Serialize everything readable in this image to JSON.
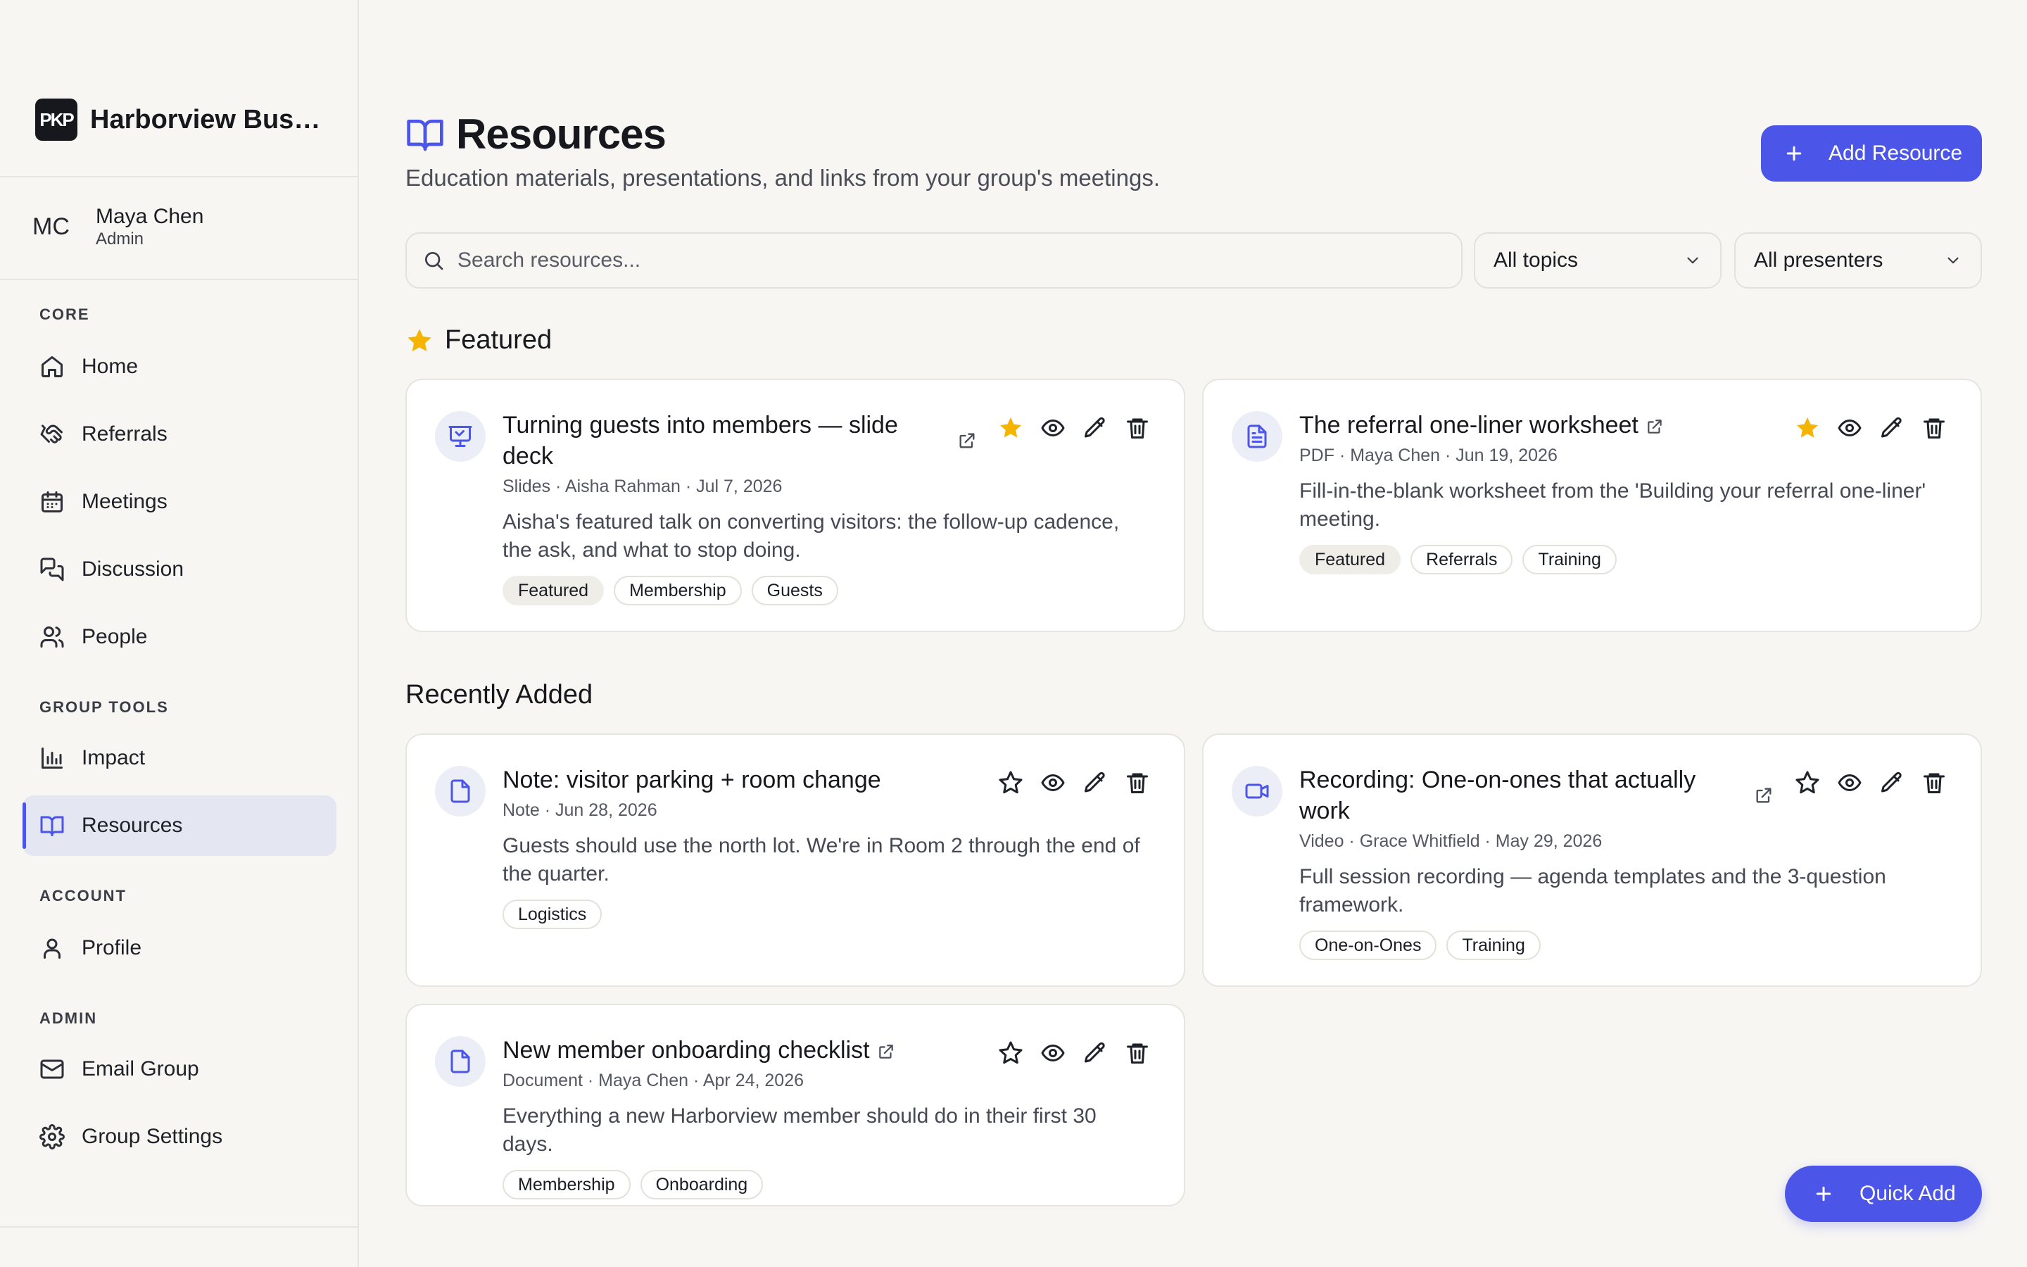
{
  "app": {
    "brand_name": "Harborview Busi...",
    "logo_text": "PKP"
  },
  "user": {
    "initials": "MC",
    "name": "Maya Chen",
    "role": "Admin"
  },
  "sidebar": {
    "sections": [
      {
        "label": "CORE",
        "items": [
          {
            "label": "Home",
            "icon": "home-icon"
          },
          {
            "label": "Referrals",
            "icon": "handshake-icon"
          },
          {
            "label": "Meetings",
            "icon": "calendar-icon"
          },
          {
            "label": "Discussion",
            "icon": "chat-icon"
          },
          {
            "label": "People",
            "icon": "people-icon"
          }
        ]
      },
      {
        "label": "GROUP TOOLS",
        "items": [
          {
            "label": "Impact",
            "icon": "bar-chart-icon"
          },
          {
            "label": "Resources",
            "icon": "book-icon",
            "active": true
          }
        ]
      },
      {
        "label": "ACCOUNT",
        "items": [
          {
            "label": "Profile",
            "icon": "user-icon"
          }
        ]
      },
      {
        "label": "ADMIN",
        "items": [
          {
            "label": "Email Group",
            "icon": "mail-icon"
          },
          {
            "label": "Group Settings",
            "icon": "gear-icon"
          }
        ]
      }
    ]
  },
  "page": {
    "title": "Resources",
    "subtitle": "Education materials, presentations, and links from your group's meetings.",
    "add_button": "Add Resource",
    "quick_add": "Quick Add"
  },
  "filters": {
    "search_placeholder": "Search resources...",
    "topic": "All topics",
    "presenter": "All presenters"
  },
  "sections": {
    "featured": "Featured",
    "recent": "Recently Added"
  },
  "colors": {
    "accent": "#4b55e8",
    "star": "#f4b400"
  },
  "cards": {
    "featured_1": {
      "icon": "presentation-icon",
      "title": "Turning guests into members — slide deck",
      "meta": "Slides · Aisha Rahman · Jul 7, 2026",
      "desc": "Aisha's featured talk on converting visitors: the follow-up cadence, the ask, and what to stop doing.",
      "tags": [
        "Featured",
        "Membership",
        "Guests"
      ],
      "starred": true
    },
    "featured_2": {
      "icon": "document-icon",
      "title": "The referral one-liner worksheet",
      "meta": "PDF · Maya Chen · Jun 19, 2026",
      "desc": "Fill-in-the-blank worksheet from the 'Building your referral one-liner' meeting.",
      "tags": [
        "Featured",
        "Referrals",
        "Training"
      ],
      "starred": true
    },
    "recent_1": {
      "icon": "note-icon",
      "title": "Note: visitor parking + room change",
      "meta": "Note · Jun 28, 2026",
      "desc": "Guests should use the north lot. We're in Room 2 through the end of the quarter.",
      "tags": [
        "Logistics"
      ],
      "starred": false
    },
    "recent_2": {
      "icon": "video-icon",
      "title": "Recording: One-on-ones that actually work",
      "meta": "Video · Grace Whitfield · May 29, 2026",
      "desc": "Full session recording — agenda templates and the 3-question framework.",
      "tags": [
        "One-on-Ones",
        "Training"
      ],
      "starred": false
    },
    "recent_3": {
      "icon": "document-icon",
      "title": "New member onboarding checklist",
      "meta": "Document · Maya Chen · Apr 24, 2026",
      "desc": "Everything a new Harborview member should do in their first 30 days.",
      "tags": [
        "Membership",
        "Onboarding"
      ],
      "starred": false
    }
  }
}
